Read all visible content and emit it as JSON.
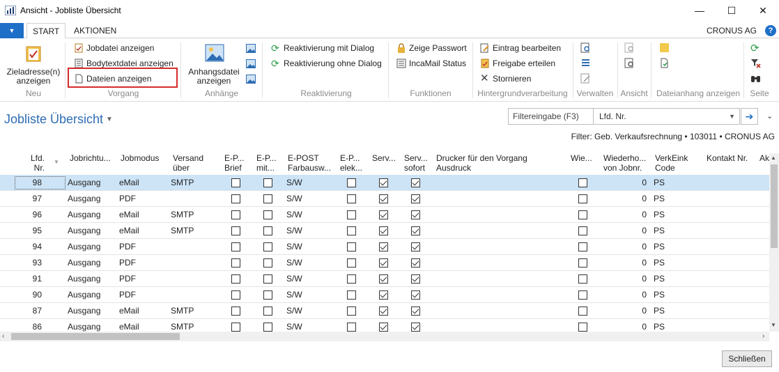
{
  "window": {
    "title": "Ansicht - Jobliste Übersicht",
    "minimize": "—",
    "maximize": "☐",
    "close": "✕"
  },
  "tabs": {
    "menu_icon": "▼",
    "start": "START",
    "aktionen": "AKTIONEN",
    "company": "CRONUS AG",
    "help": "?"
  },
  "ribbon": {
    "neu": {
      "button": "Zieladresse(n) anzeigen",
      "label": "Neu"
    },
    "vorgang": {
      "items": [
        "Jobdatei anzeigen",
        "Bodytextdatei anzeigen",
        "Dateien anzeigen"
      ],
      "label": "Vorgang"
    },
    "anhaenge": {
      "button": "Anhangsdatei anzeigen",
      "label": "Anhänge"
    },
    "reaktivierung": {
      "items": [
        "Reaktivierung mit Dialog",
        "Reaktivierung ohne Dialog"
      ],
      "label": "Reaktivierung"
    },
    "funktionen": {
      "items": [
        "Zeige Passwort",
        "IncaMail Status"
      ],
      "label": "Funktionen"
    },
    "hintergrund": {
      "items": [
        "Eintrag bearbeiten",
        "Freigabe erteilen",
        "Stornieren"
      ],
      "label": "Hintergrundverarbeitung"
    },
    "verwalten": {
      "label": "Verwalten"
    },
    "ansicht": {
      "label": "Ansicht"
    },
    "dateianhang": {
      "label": "Dateianhang anzeigen"
    },
    "seite": {
      "label": "Seite"
    }
  },
  "page": {
    "title": "Jobliste Übersicht",
    "filter_label": "Filtereingabe (F3)",
    "filter_field": "Lfd. Nr.",
    "filter_summary": "Filter: Geb. Verkaufsrechnung • 103011 • CRONUS AG",
    "close_button": "Schließen"
  },
  "columns": [
    "Lfd.\nNr.",
    "Jobrichtu...",
    "Jobmodus",
    "Versand\nüber",
    "E-P...\nBrief",
    "E-P...\nmit...",
    "E-POST\nFarbausw...",
    "E-P...\nelek...",
    "Serv...",
    "Serv...\nsofort",
    "Drucker für den Vorgang\nAusdruck",
    "Wie...",
    "Wiederho...\nvon Jobnr.",
    "VerkEink\nCode",
    "Kontakt Nr.",
    "Ak"
  ],
  "rows": [
    {
      "nr": "98",
      "richtung": "Ausgang",
      "modus": "eMail",
      "versand": "SMTP",
      "brief": false,
      "mit": false,
      "farb": "S/W",
      "elek": false,
      "serv": true,
      "sofort": true,
      "wie": false,
      "wiederholung": "0",
      "code": "PS"
    },
    {
      "nr": "97",
      "richtung": "Ausgang",
      "modus": "PDF",
      "versand": "",
      "brief": false,
      "mit": false,
      "farb": "S/W",
      "elek": false,
      "serv": true,
      "sofort": true,
      "wie": false,
      "wiederholung": "0",
      "code": "PS"
    },
    {
      "nr": "96",
      "richtung": "Ausgang",
      "modus": "eMail",
      "versand": "SMTP",
      "brief": false,
      "mit": false,
      "farb": "S/W",
      "elek": false,
      "serv": true,
      "sofort": true,
      "wie": false,
      "wiederholung": "0",
      "code": "PS"
    },
    {
      "nr": "95",
      "richtung": "Ausgang",
      "modus": "eMail",
      "versand": "SMTP",
      "brief": false,
      "mit": false,
      "farb": "S/W",
      "elek": false,
      "serv": true,
      "sofort": true,
      "wie": false,
      "wiederholung": "0",
      "code": "PS"
    },
    {
      "nr": "94",
      "richtung": "Ausgang",
      "modus": "PDF",
      "versand": "",
      "brief": false,
      "mit": false,
      "farb": "S/W",
      "elek": false,
      "serv": true,
      "sofort": true,
      "wie": false,
      "wiederholung": "0",
      "code": "PS"
    },
    {
      "nr": "93",
      "richtung": "Ausgang",
      "modus": "PDF",
      "versand": "",
      "brief": false,
      "mit": false,
      "farb": "S/W",
      "elek": false,
      "serv": true,
      "sofort": true,
      "wie": false,
      "wiederholung": "0",
      "code": "PS"
    },
    {
      "nr": "91",
      "richtung": "Ausgang",
      "modus": "PDF",
      "versand": "",
      "brief": false,
      "mit": false,
      "farb": "S/W",
      "elek": false,
      "serv": true,
      "sofort": true,
      "wie": false,
      "wiederholung": "0",
      "code": "PS"
    },
    {
      "nr": "90",
      "richtung": "Ausgang",
      "modus": "PDF",
      "versand": "",
      "brief": false,
      "mit": false,
      "farb": "S/W",
      "elek": false,
      "serv": true,
      "sofort": true,
      "wie": false,
      "wiederholung": "0",
      "code": "PS"
    },
    {
      "nr": "87",
      "richtung": "Ausgang",
      "modus": "eMail",
      "versand": "SMTP",
      "brief": false,
      "mit": false,
      "farb": "S/W",
      "elek": false,
      "serv": true,
      "sofort": true,
      "wie": false,
      "wiederholung": "0",
      "code": "PS"
    },
    {
      "nr": "86",
      "richtung": "Ausgang",
      "modus": "eMail",
      "versand": "SMTP",
      "brief": false,
      "mit": false,
      "farb": "S/W",
      "elek": false,
      "serv": true,
      "sofort": true,
      "wie": false,
      "wiederholung": "0",
      "code": "PS"
    }
  ],
  "colors": {
    "accent": "#1e6fc7",
    "selection": "#cde4f7",
    "highlight_border": "#d62b2b"
  }
}
